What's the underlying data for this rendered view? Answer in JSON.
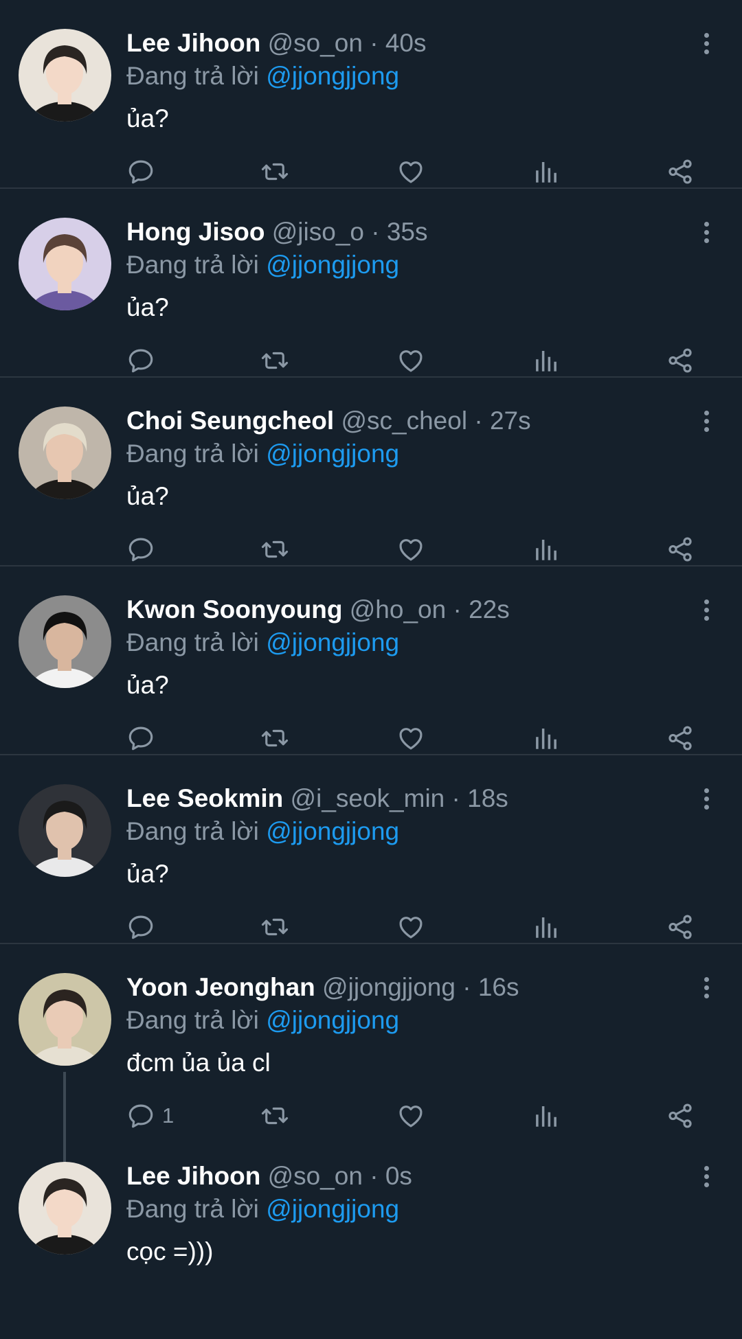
{
  "reply_prefix": "Đang trả lời",
  "tweets": [
    {
      "name": "Lee Jihoon",
      "handle": "@so_on",
      "separator": "·",
      "time": "40s",
      "reply_to": "@jjongjjong",
      "text": "ủa?",
      "reply_count": ""
    },
    {
      "name": "Hong Jisoo",
      "handle": "@jiso_o",
      "separator": "·",
      "time": "35s",
      "reply_to": "@jjongjjong",
      "text": "ủa?",
      "reply_count": ""
    },
    {
      "name": "Choi Seungcheol",
      "handle": "@sc_cheol",
      "separator": "·",
      "time": "27s",
      "reply_to": "@jjongjjong",
      "text": "ủa?",
      "reply_count": ""
    },
    {
      "name": "Kwon Soonyoung",
      "handle": "@ho_on",
      "separator": "·",
      "time": "22s",
      "reply_to": "@jjongjjong",
      "text": "ủa?",
      "reply_count": ""
    },
    {
      "name": "Lee Seokmin",
      "handle": "@i_seok_min",
      "separator": "·",
      "time": "18s",
      "reply_to": "@jjongjjong",
      "text": "ủa?",
      "reply_count": ""
    },
    {
      "name": "Yoon Jeonghan",
      "handle": "@jjongjjong",
      "separator": "·",
      "time": "16s",
      "reply_to": "@jjongjjong",
      "text": "đcm ủa ủa cl",
      "reply_count": "1"
    },
    {
      "name": "Lee Jihoon",
      "handle": "@so_on",
      "separator": "·",
      "time": "0s",
      "reply_to": "@jjongjjong",
      "text": "cọc =)))",
      "reply_count": ""
    }
  ],
  "icons": [
    "reply-icon",
    "retweet-icon",
    "like-icon",
    "stats-icon",
    "share-icon",
    "more-icon"
  ],
  "colors": {
    "background": "#15202b",
    "link": "#1d9bf0",
    "muted": "#8b98a5",
    "text": "#ffffff"
  }
}
